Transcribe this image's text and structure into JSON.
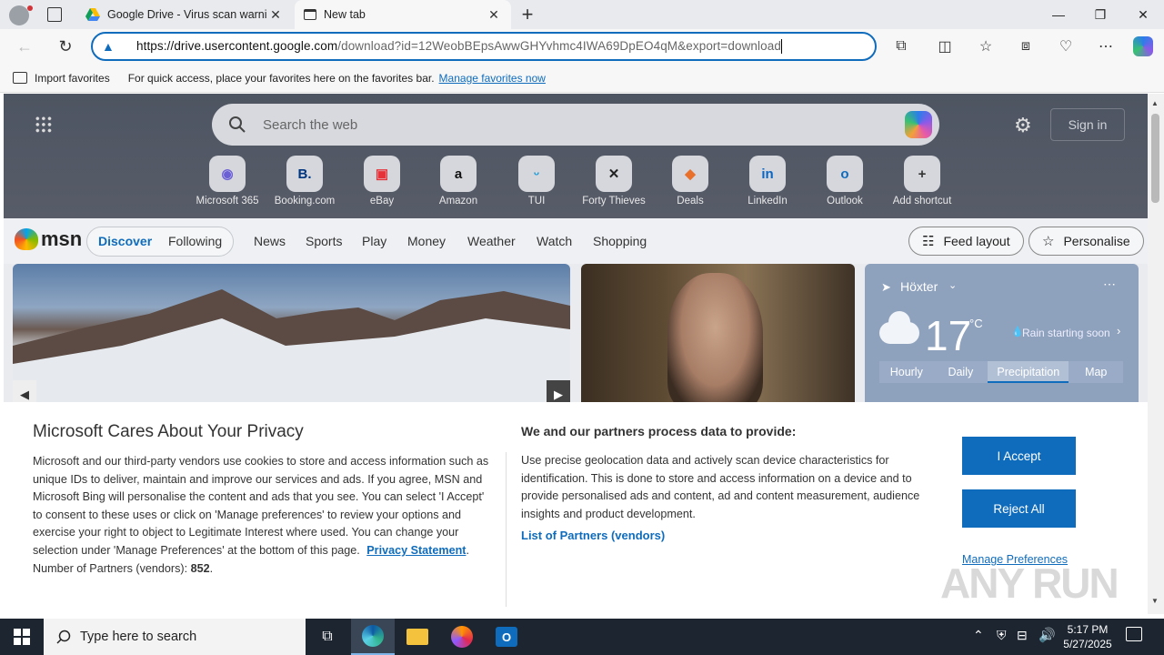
{
  "tabs": [
    {
      "title": "Google Drive - Virus scan warnin",
      "active": false
    },
    {
      "title": "New tab",
      "active": true
    }
  ],
  "address_bar": {
    "url_host": "https://drive.usercontent.google.com",
    "url_path": "/download?id=12WeobBEpsAwwGHYvhmc4IWA69DpEO4qM&export=download"
  },
  "favorites_bar": {
    "import_label": "Import favorites",
    "hint": "For quick access, place your favorites here on the favorites bar.",
    "manage_link": "Manage favorites now"
  },
  "new_tab": {
    "search_placeholder": "Search the web",
    "sign_in": "Sign in",
    "shortcuts": [
      {
        "label": "Microsoft 365",
        "glyph": "◉",
        "color": "#6b5fd6"
      },
      {
        "label": "Booking.com",
        "glyph": "B.",
        "color": "#003580"
      },
      {
        "label": "eBay",
        "glyph": "▣",
        "color": "#e53238"
      },
      {
        "label": "Amazon",
        "glyph": "a",
        "color": "#111111"
      },
      {
        "label": "TUI",
        "glyph": "ᵕ",
        "color": "#1a9ad9"
      },
      {
        "label": "Forty Thieves",
        "glyph": "✕",
        "color": "#222222"
      },
      {
        "label": "Deals",
        "glyph": "◆",
        "color": "#e8702a"
      },
      {
        "label": "LinkedIn",
        "glyph": "in",
        "color": "#0a66c2"
      },
      {
        "label": "Outlook",
        "glyph": "o",
        "color": "#0f6cbd"
      },
      {
        "label": "Add shortcut",
        "glyph": "+",
        "color": "#333333"
      }
    ]
  },
  "msn": {
    "logo": "msn",
    "tabs": [
      "Discover",
      "Following"
    ],
    "nav": [
      "News",
      "Sports",
      "Play",
      "Money",
      "Weather",
      "Watch",
      "Shopping"
    ],
    "feed_layout": "Feed layout",
    "personalise": "Personalise"
  },
  "weather": {
    "location": "Höxter",
    "temp": "17",
    "unit": "°C",
    "note": "Rain starting soon",
    "tabs": [
      "Hourly",
      "Daily",
      "Precipitation",
      "Map"
    ]
  },
  "privacy": {
    "title": "Microsoft Cares About Your Privacy",
    "body": "Microsoft and our third-party vendors use cookies to store and access information such as unique IDs to deliver, maintain and improve our services and ads. If you agree, MSN and Microsoft Bing will personalise the content and ads that you see. You can select 'I Accept' to consent to these uses or click on 'Manage preferences' to review your options and exercise your right to object to Legitimate Interest where used.  You can change your selection under 'Manage Preferences' at the bottom of this page.",
    "privacy_link": "Privacy Statement",
    "partners_label": "Number of Partners (vendors):",
    "partners_count": "852",
    "purposes_title": "We and our partners process data to provide:",
    "purposes_body": "Use precise geolocation data and actively scan device characteristics for identification. This is done to store and access information on a device and to provide personalised ads and content, ad and content measurement, audience insights and product development.",
    "partners_link": "List of Partners (vendors)",
    "accept": "I Accept",
    "reject": "Reject All",
    "manage": "Manage Preferences"
  },
  "taskbar": {
    "search_placeholder": "Type here to search",
    "time": "5:17 PM",
    "date": "5/27/2025"
  },
  "watermark": "ANY RUN",
  "colors": {
    "accent": "#0f6cbd",
    "taskbar": "#1c2530"
  }
}
